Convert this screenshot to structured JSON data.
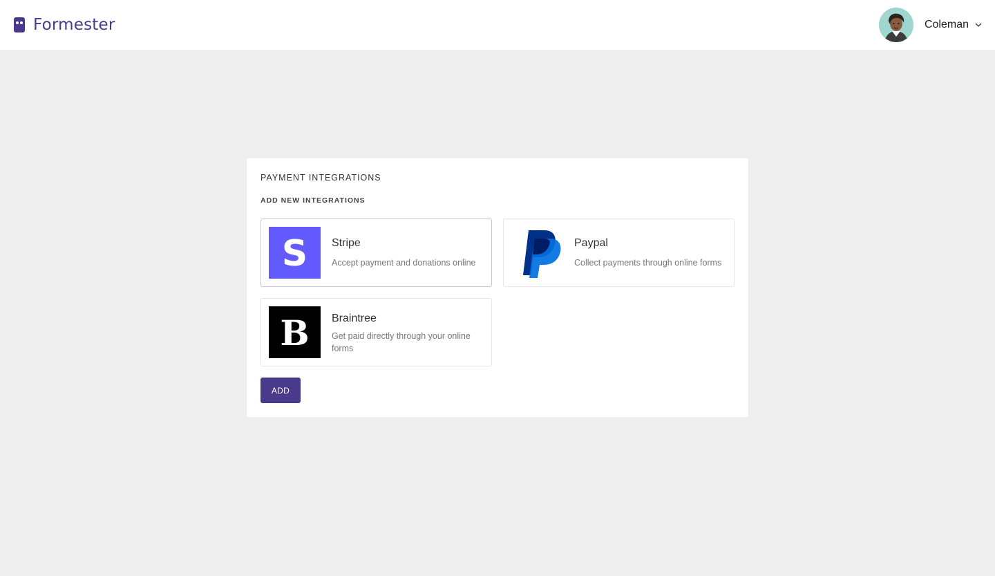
{
  "header": {
    "brand_name": "Formester",
    "user_name": "Coleman"
  },
  "panel": {
    "title": "PAYMENT INTEGRATIONS",
    "section_title": "ADD NEW INTEGRATIONS",
    "integrations": [
      {
        "name": "Stripe",
        "description": "Accept payment and donations online",
        "selected": true,
        "icon": "stripe-icon",
        "color": "#635bff"
      },
      {
        "name": "Paypal",
        "description": "Collect payments through online forms",
        "selected": false,
        "icon": "paypal-icon",
        "color": "#003087"
      },
      {
        "name": "Braintree",
        "description": "Get paid directly through your online forms",
        "selected": false,
        "icon": "braintree-icon",
        "color": "#000000"
      }
    ],
    "add_label": "ADD"
  },
  "colors": {
    "brand": "#4a3a8c",
    "background": "#efefef"
  }
}
